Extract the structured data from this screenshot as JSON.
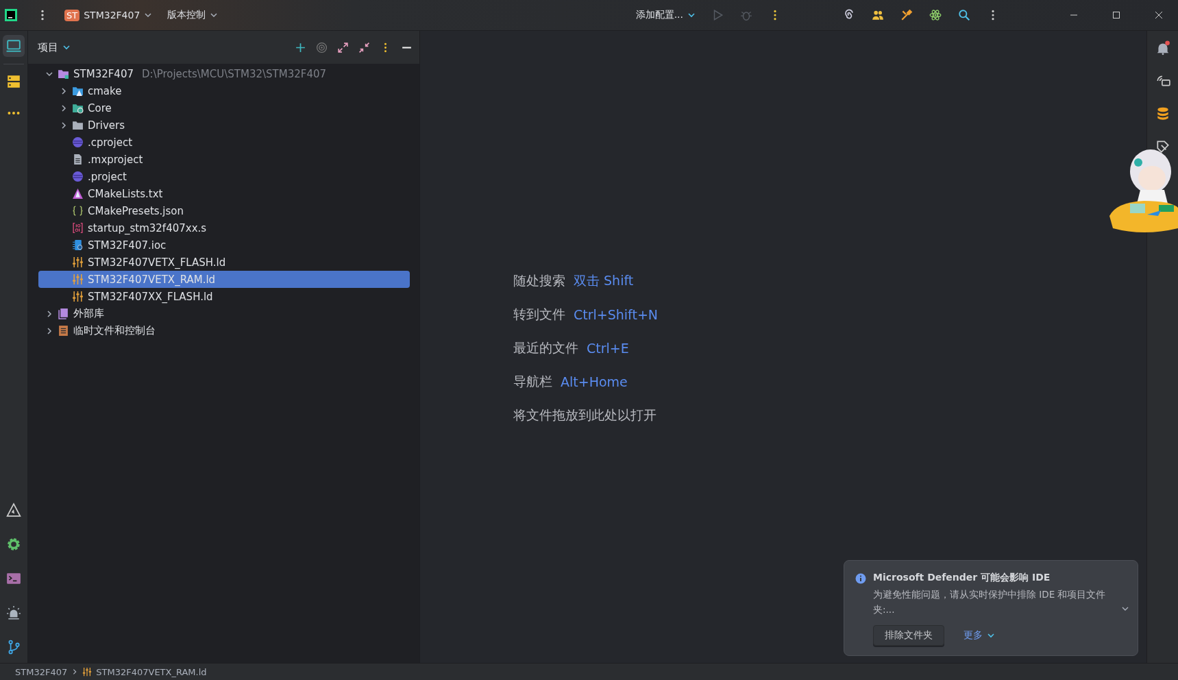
{
  "title_bar": {
    "project_badge": "ST",
    "project": "STM32F407",
    "vcs": "版本控制",
    "run_config": "添加配置..."
  },
  "project_panel": {
    "title": "项目",
    "tree": [
      {
        "label": "STM32F407",
        "path": "D:\\Projects\\MCU\\STM32\\STM32F407",
        "kind": "project",
        "expanded": true,
        "selected": false,
        "children": [
          {
            "label": "cmake",
            "kind": "folder-cmake",
            "expanded": false,
            "selected": false
          },
          {
            "label": "Core",
            "kind": "folder-core",
            "expanded": false,
            "selected": false
          },
          {
            "label": "Drivers",
            "kind": "folder",
            "expanded": false,
            "selected": false
          },
          {
            "label": ".cproject",
            "kind": "eclipse",
            "selected": false
          },
          {
            "label": ".mxproject",
            "kind": "text",
            "selected": false
          },
          {
            "label": ".project",
            "kind": "eclipse",
            "selected": false
          },
          {
            "label": "CMakeLists.txt",
            "kind": "cmake",
            "selected": false
          },
          {
            "label": "CMakePresets.json",
            "kind": "json",
            "selected": false
          },
          {
            "label": "startup_stm32f407xx.s",
            "kind": "asm",
            "selected": false
          },
          {
            "label": "STM32F407.ioc",
            "kind": "ioc",
            "selected": false
          },
          {
            "label": "STM32F407VETX_FLASH.ld",
            "kind": "ld",
            "selected": false
          },
          {
            "label": "STM32F407VETX_RAM.ld",
            "kind": "ld",
            "selected": true
          },
          {
            "label": "STM32F407XX_FLASH.ld",
            "kind": "ld",
            "selected": false
          }
        ]
      },
      {
        "label": "外部库",
        "kind": "library",
        "expanded": false,
        "selected": false
      },
      {
        "label": "临时文件和控制台",
        "kind": "scratch",
        "expanded": false,
        "selected": false
      }
    ]
  },
  "editor_hints": [
    {
      "action": "随处搜索",
      "shortcut": "双击 Shift"
    },
    {
      "action": "转到文件",
      "shortcut": "Ctrl+Shift+N"
    },
    {
      "action": "最近的文件",
      "shortcut": "Ctrl+E"
    },
    {
      "action": "导航栏",
      "shortcut": "Alt+Home"
    },
    {
      "action": "将文件拖放到此处以打开"
    }
  ],
  "notification": {
    "title": "Microsoft Defender 可能会影响 IDE",
    "body": "为避免性能问题，请从实时保护中排除 IDE 和项目文件夹:...",
    "button": "排除文件夹",
    "more": "更多"
  },
  "status_bar": {
    "breadcrumbs": [
      {
        "label": "STM32F407",
        "kind": "project"
      },
      {
        "label": "STM32F407VETX_RAM.ld",
        "kind": "ld"
      }
    ]
  }
}
